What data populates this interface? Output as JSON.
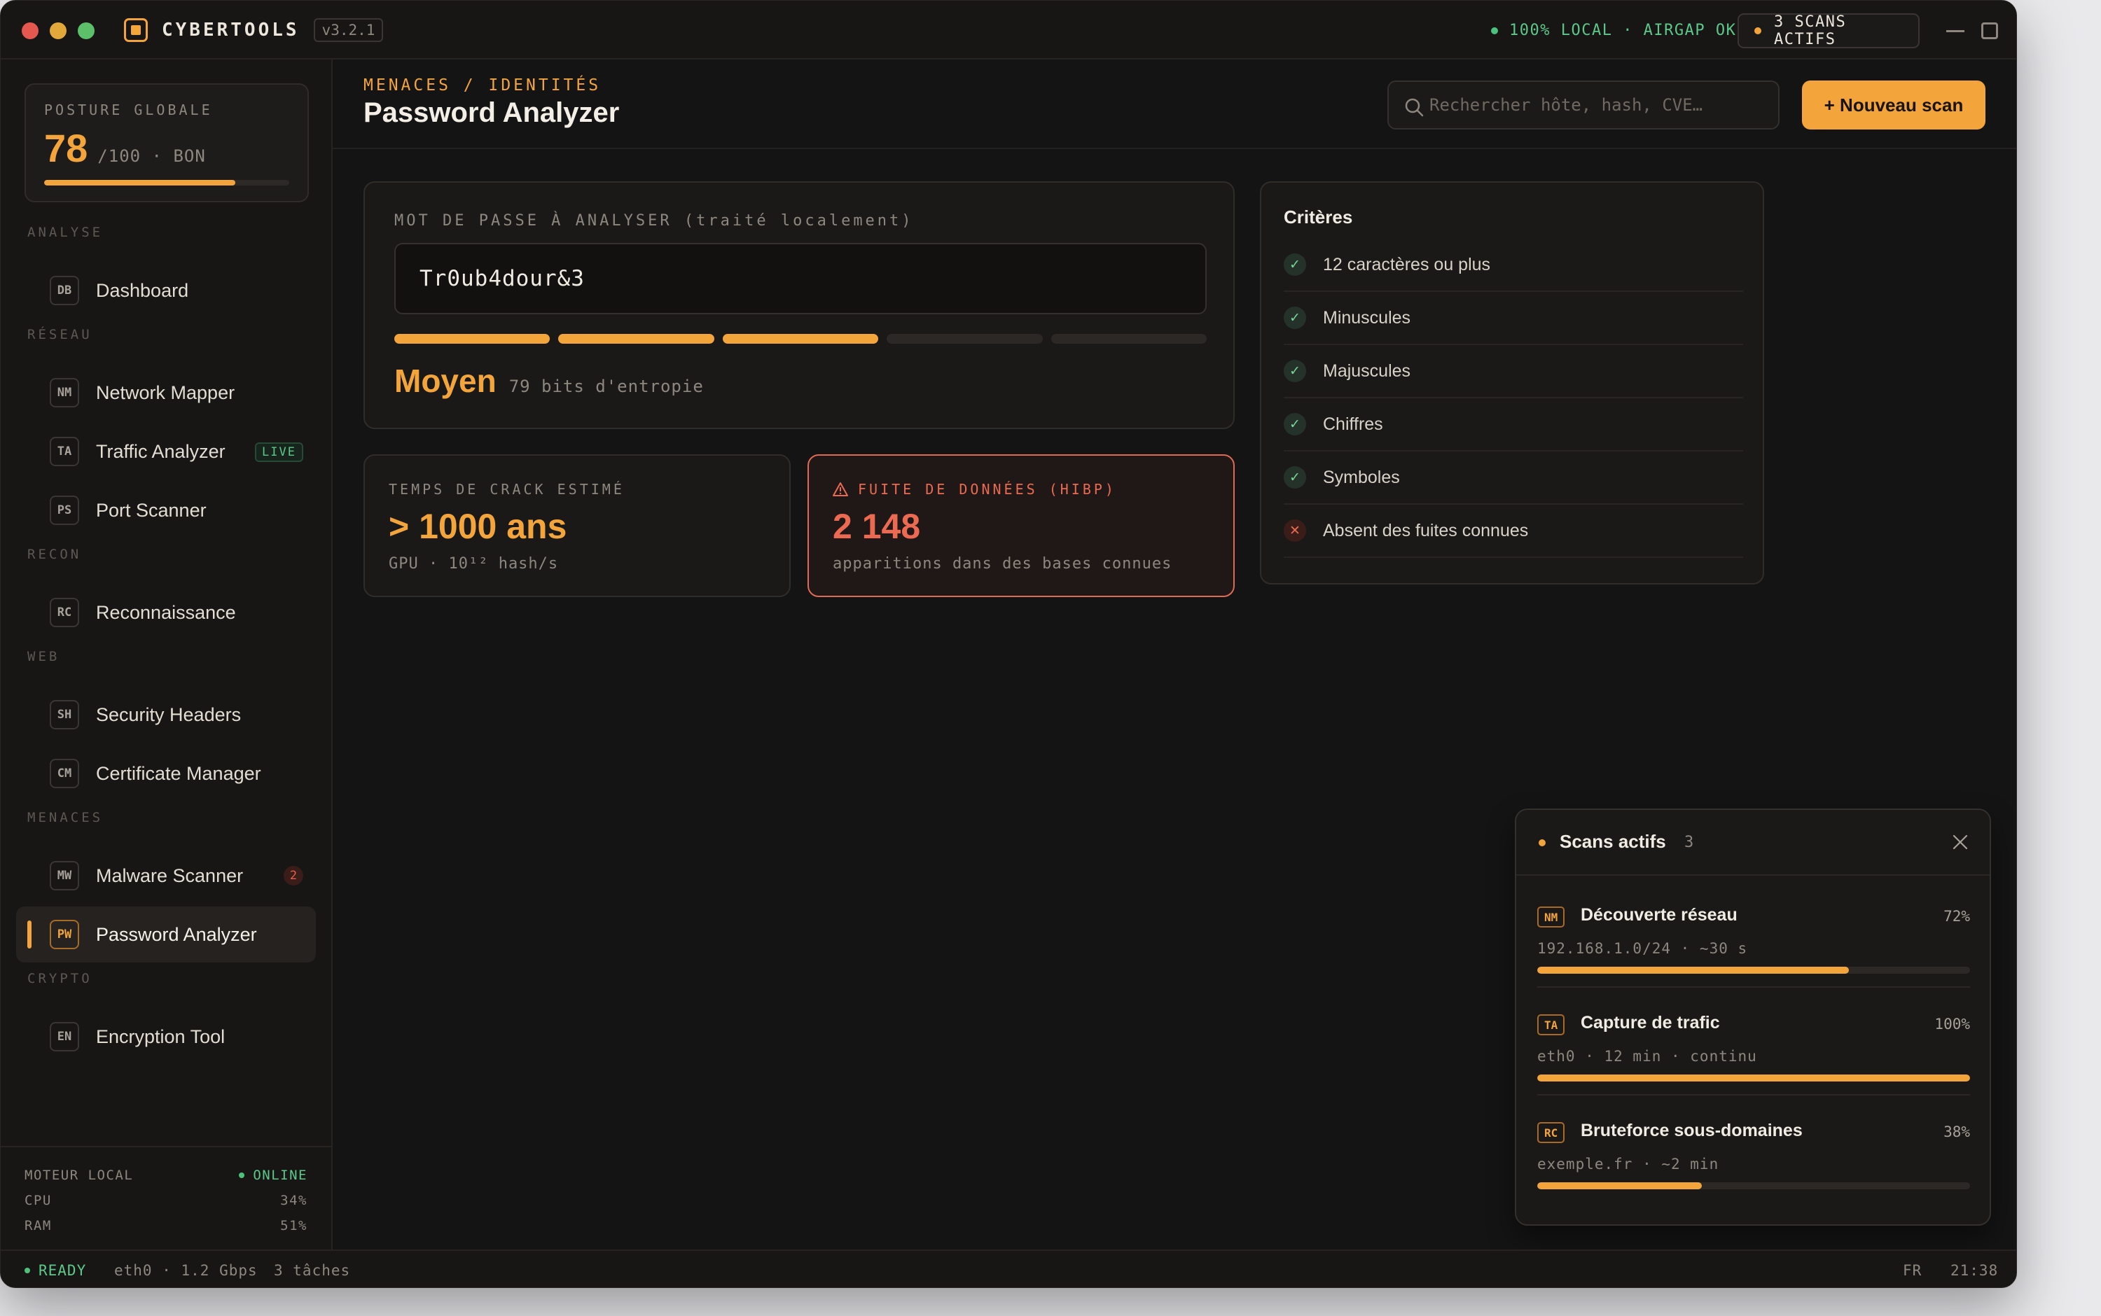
{
  "window": {
    "brand": "CYBERTOOLS",
    "version": "v3.2.1",
    "status": "100% LOCAL · AIRGAP OK",
    "scans_active": "3 SCANS ACTIFS"
  },
  "sidebar": {
    "posture": {
      "label": "POSTURE GLOBALE",
      "score": "78",
      "sub": "/100 · BON",
      "level": 0.78
    },
    "sections": [
      {
        "title": "ANALYSE",
        "items": [
          {
            "code": "DB",
            "label": "Dashboard"
          }
        ]
      },
      {
        "title": "RÉSEAU",
        "items": [
          {
            "code": "NM",
            "label": "Network Mapper"
          },
          {
            "code": "TA",
            "label": "Traffic Analyzer",
            "badge": "LIVE"
          },
          {
            "code": "PS",
            "label": "Port Scanner"
          }
        ]
      },
      {
        "title": "RECON",
        "items": [
          {
            "code": "RC",
            "label": "Reconnaissance"
          }
        ]
      },
      {
        "title": "WEB",
        "items": [
          {
            "code": "SH",
            "label": "Security Headers"
          },
          {
            "code": "CM",
            "label": "Certificate Manager"
          }
        ]
      },
      {
        "title": "MENACES",
        "items": [
          {
            "code": "MW",
            "label": "Malware Scanner",
            "count": "2"
          },
          {
            "code": "PW",
            "label": "Password Analyzer",
            "active": true
          }
        ]
      },
      {
        "title": "CRYPTO",
        "items": [
          {
            "code": "EN",
            "label": "Encryption Tool"
          }
        ]
      }
    ],
    "engine": {
      "label": "MOTEUR LOCAL",
      "status": "ONLINE",
      "cpu_label": "CPU",
      "cpu": "34%",
      "ram_label": "RAM",
      "ram": "51%"
    }
  },
  "header": {
    "breadcrumb": "MENACES / IDENTITÉS",
    "title": "Password Analyzer",
    "search_placeholder": "Rechercher hôte, hash, CVE…",
    "new_scan": "+ Nouveau scan"
  },
  "analyzer": {
    "label": "MOT DE PASSE À ANALYSER (traité localement)",
    "value": "Tr0ub4dour&3",
    "strength_segments": 5,
    "strength_filled": 3,
    "verdict": "Moyen",
    "entropy": "79 bits d'entropie"
  },
  "crack": {
    "label": "TEMPS DE CRACK ESTIMÉ",
    "value": "> 1000 ans",
    "sub": "GPU · 10¹² hash/s"
  },
  "leak": {
    "label": "FUITE DE DONNÉES (HIBP)",
    "value": "2 148",
    "sub": "apparitions dans des bases connues"
  },
  "criteria": {
    "title": "Critères",
    "items": [
      {
        "label": "12 caractères ou plus",
        "ok": true
      },
      {
        "label": "Minuscules",
        "ok": true
      },
      {
        "label": "Majuscules",
        "ok": true
      },
      {
        "label": "Chiffres",
        "ok": true
      },
      {
        "label": "Symboles",
        "ok": true
      },
      {
        "label": "Absent des fuites connues",
        "ok": false
      }
    ]
  },
  "scans_panel": {
    "title": "Scans actifs",
    "count": "3",
    "items": [
      {
        "code": "NM",
        "name": "Découverte réseau",
        "pct": "72%",
        "meta": "192.168.1.0/24 · ~30 s",
        "progress": 0.72
      },
      {
        "code": "TA",
        "name": "Capture de trafic",
        "pct": "100%",
        "meta": "eth0 · 12 min · continu",
        "progress": 1.0
      },
      {
        "code": "RC",
        "name": "Bruteforce sous-domaines",
        "pct": "38%",
        "meta": "exemple.fr · ~2 min",
        "progress": 0.38
      }
    ]
  },
  "statusbar": {
    "ready": "READY",
    "iface": "eth0 · 1.2 Gbps",
    "tasks": "3 tâches",
    "lang": "FR",
    "time": "21:38"
  },
  "colors": {
    "accent": "#f3a43b",
    "danger": "#ec6a52",
    "ok": "#5cc98a",
    "bg": "#151414"
  }
}
